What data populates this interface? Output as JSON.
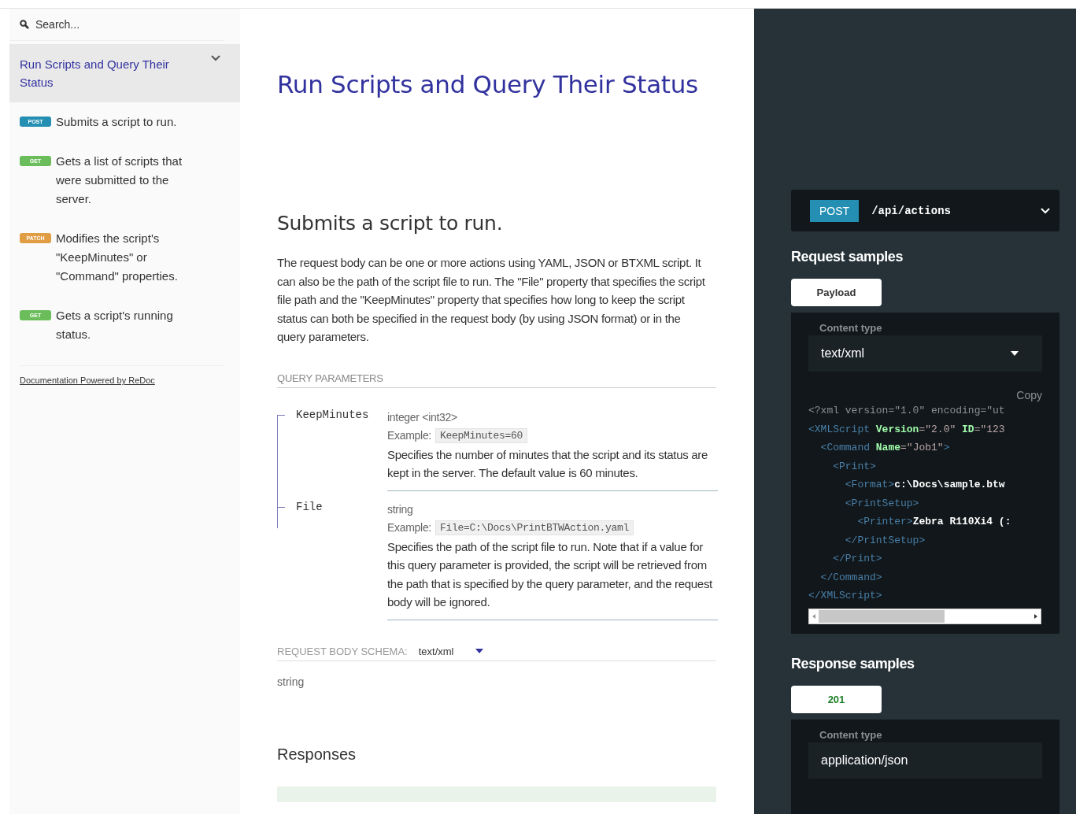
{
  "sidebar": {
    "search": {
      "placeholder": "Search..."
    },
    "group": {
      "title": "Run Scripts and Query Their Status",
      "expanded": true
    },
    "items": [
      {
        "kind": "post",
        "badge": "POST",
        "label": "Submits a script to run."
      },
      {
        "kind": "get",
        "badge": "GET",
        "label": "Gets a list of scripts that were submitted to the server."
      },
      {
        "kind": "patch",
        "badge": "PATCH",
        "label": "Modifies the script's \"KeepMinutes\" or \"Command\" properties."
      },
      {
        "kind": "get",
        "badge": "GET",
        "label": "Gets a script's running status."
      }
    ],
    "footer_link": "Documentation Powered by ReDoc"
  },
  "content": {
    "title": "Run Scripts and Query Their Status",
    "operation": "Submits a script to run.",
    "description": "The request body can be one or more actions using YAML, JSON or BTXML script. It can also be the path of the script file to run. The \"File\" property that specifies the script file path and the \"KeepMinutes\" property that specifies how long to keep the script status can both be specified in the request body (by using JSON format) or in the query parameters.",
    "query_header": "QUERY PARAMETERS",
    "params": [
      {
        "name": "KeepMinutes",
        "type": "integer <int32>",
        "example_label": "Example:",
        "example": "KeepMinutes=60",
        "description": "Specifies the number of minutes that the script and its status are kept in the server. The default value is 60 minutes."
      },
      {
        "name": "File",
        "type": "string",
        "example_label": "Example:",
        "example": "File=C:\\Docs\\PrintBTWAction.yaml",
        "description": "Specifies the path of the script file to run. Note that if a value for this query parameter is provided, the script will be retrieved from the path that is specified by the query parameter, and the request body will be ignored."
      }
    ],
    "body_schema": {
      "label": "REQUEST BODY SCHEMA:",
      "value": "text/xml",
      "type": "string"
    },
    "responses_title": "Responses"
  },
  "panel": {
    "endpoint": {
      "method": "POST",
      "path": "/api/actions"
    },
    "request": {
      "title": "Request samples",
      "tabs": [
        {
          "label": "Payload",
          "selected": true
        }
      ],
      "content_type_label": "Content type",
      "content_type": "text/xml",
      "copy": "Copy",
      "code": [
        [
          {
            "kind": "punct",
            "text": "<?xml version=\"1.0\" encoding=\"ut"
          }
        ],
        [
          {
            "kind": "tag",
            "text": "<XMLScript"
          },
          {
            "kind": "attr",
            "text": " Version"
          },
          {
            "kind": "value",
            "text": "=\"2.0\""
          },
          {
            "kind": "attr",
            "text": " ID"
          },
          {
            "kind": "value",
            "text": "=\"123"
          }
        ],
        [
          {
            "kind": "tag",
            "text": "  <Command"
          },
          {
            "kind": "attr",
            "text": " Name"
          },
          {
            "kind": "value",
            "text": "=\"Job1\""
          },
          {
            "kind": "tag",
            "text": ">"
          }
        ],
        [
          {
            "kind": "tag",
            "text": "    <Print>"
          }
        ],
        [
          {
            "kind": "tag",
            "text": "      <Format>"
          },
          {
            "kind": "text",
            "text": "c:\\Docs\\sample.btw"
          }
        ],
        [
          {
            "kind": "tag",
            "text": "      <PrintSetup>"
          }
        ],
        [
          {
            "kind": "tag",
            "text": "        <Printer>"
          },
          {
            "kind": "text",
            "text": "Zebra R110Xi4 (:"
          }
        ],
        [
          {
            "kind": "tag",
            "text": "      </PrintSetup>"
          }
        ],
        [
          {
            "kind": "tag",
            "text": "    </Print>"
          }
        ],
        [
          {
            "kind": "tag",
            "text": "  </Command>"
          }
        ],
        [
          {
            "kind": "tag",
            "text": "</XMLScript>"
          }
        ]
      ]
    },
    "response": {
      "title": "Response samples",
      "tabs": [
        {
          "label": "201",
          "selected": true
        }
      ],
      "content_type_label": "Content type",
      "content_type": "application/json"
    }
  }
}
